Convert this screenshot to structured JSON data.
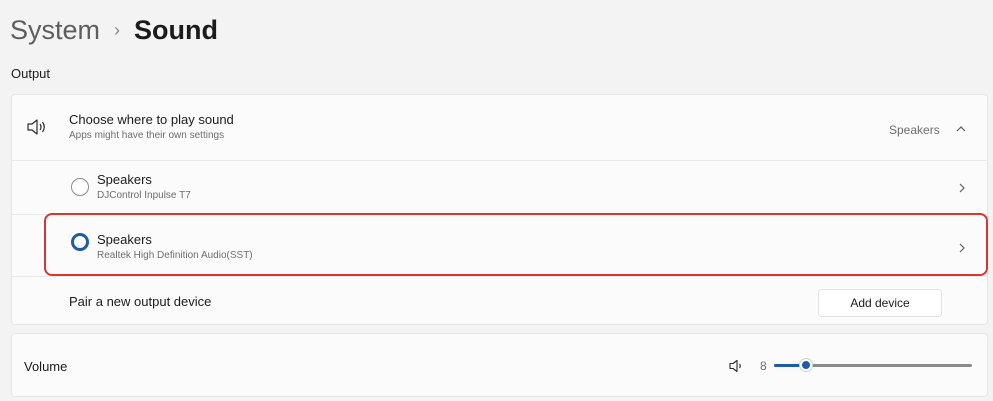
{
  "breadcrumb": {
    "parent": "System",
    "separator": "›",
    "current": "Sound"
  },
  "output": {
    "section_label": "Output",
    "choose": {
      "title": "Choose where to play sound",
      "subtitle": "Apps might have their own settings",
      "selected_value": "Speakers",
      "icon": "speaker-icon",
      "expanded": true
    },
    "devices": [
      {
        "name": "Speakers",
        "detail": "DJControl Inpulse T7",
        "selected": false
      },
      {
        "name": "Speakers",
        "detail": "Realtek High Definition Audio(SST)",
        "selected": true
      }
    ],
    "pair": {
      "label": "Pair a new output device",
      "button_label": "Add device"
    }
  },
  "volume": {
    "label": "Volume",
    "value": "8",
    "level": 0.08,
    "icon": "speaker-icon"
  },
  "colors": {
    "accent": "#1f5aa8",
    "highlight_border": "#d9362f"
  }
}
